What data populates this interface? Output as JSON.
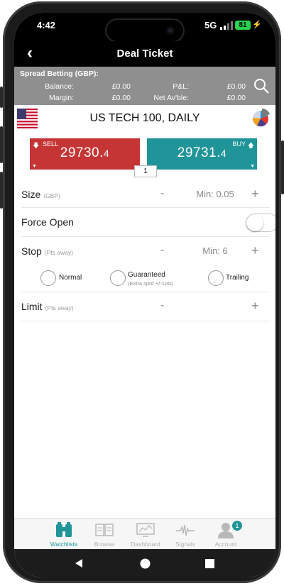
{
  "status": {
    "time": "4:42",
    "network": "5G",
    "battery": "81"
  },
  "header": {
    "title": "Deal Ticket",
    "back_icon": "chevron-left-icon"
  },
  "account": {
    "heading": "Spread Betting (GBP):",
    "balance_label": "Balance:",
    "balance_value": "£0.00",
    "pnl_label": "P&L:",
    "pnl_value": "£0.00",
    "margin_label": "Margin:",
    "margin_value": "£0.00",
    "available_label": "Net Av'ble:",
    "available_value": "£0.00"
  },
  "market": {
    "name": "US TECH 100, DAILY",
    "flag": "us-flag-icon"
  },
  "prices": {
    "sell_label": "SELL",
    "sell_main": "29730.",
    "sell_last": "4",
    "buy_label": "BUY",
    "buy_main": "29731.",
    "buy_last": "4",
    "spread": "1",
    "sell_color": "#c63535",
    "buy_color": "#1f9499"
  },
  "size": {
    "label": "Size",
    "sub": "(GBP)",
    "minus": "-",
    "value": "Min: 0.05",
    "plus": "+"
  },
  "force_open": {
    "label": "Force Open",
    "on": false
  },
  "stop": {
    "label": "Stop",
    "sub": "(Pts away)",
    "minus": "-",
    "value": "Min: 6",
    "plus": "+"
  },
  "stop_types": [
    {
      "label": "Normal",
      "note": ""
    },
    {
      "label": "Guaranteed",
      "note": "(Extra sprd +/-1pts)"
    },
    {
      "label": "Trailing",
      "note": ""
    }
  ],
  "limit": {
    "label": "Limit",
    "sub": "(Pts away)",
    "minus": "-",
    "plus": "+"
  },
  "tabs": [
    {
      "label": "Watchlists",
      "active": true
    },
    {
      "label": "Browse"
    },
    {
      "label": "Dashboard"
    },
    {
      "label": "Signals"
    },
    {
      "label": "Account",
      "badge": "1"
    }
  ],
  "accent_color": "#1f9499"
}
